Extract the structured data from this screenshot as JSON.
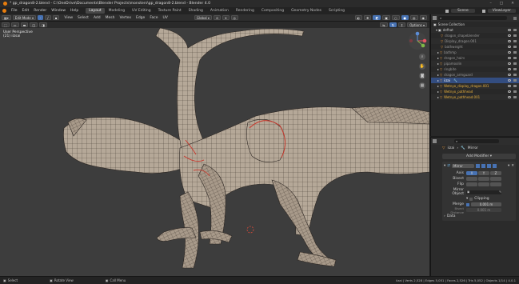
{
  "window": {
    "title": "* gp_dragon8-2.blend - C:\\OneDrive\\Documents\\Blender Projects\\monsters\\gp_dragon8-2.blend - Blender 4.0",
    "controls": [
      "–",
      "□",
      "✕"
    ]
  },
  "menu": [
    "File",
    "Edit",
    "Render",
    "Window",
    "Help"
  ],
  "workspaces": [
    "Layout",
    "Modeling",
    "UV Editing",
    "Texture Paint",
    "Shading",
    "Animation",
    "Rendering",
    "Compositing",
    "Geometry Nodes",
    "Scripting"
  ],
  "active_workspace": "Layout",
  "scene": {
    "label": "Scene",
    "view_layer": "ViewLayer"
  },
  "viewport_header": {
    "mode": "Edit Mode",
    "menus": [
      "View",
      "Select",
      "Add",
      "Mesh",
      "Vertex",
      "Edge",
      "Face",
      "UV"
    ],
    "transform_orientation": "Global",
    "options": "Options"
  },
  "viewport": {
    "perspective": "User Perspective",
    "object_label": "(21) iizsai",
    "accent_wire": "#c83a2e",
    "mesh_color": "#b7aa9a"
  },
  "outliner": {
    "search_placeholder": "",
    "rows": [
      {
        "label": "Scene Collection",
        "indent": 0,
        "icon": "collection"
      },
      {
        "label": "defhat",
        "indent": 1,
        "icon": "collection"
      },
      {
        "label": "dragon_shapeblender",
        "indent": 2,
        "icon": "mesh"
      },
      {
        "label": "Display_dragon.001",
        "indent": 2,
        "icon": "mesh"
      },
      {
        "label": "bathweight",
        "indent": 2,
        "icon": "mesh"
      },
      {
        "label": "bathmp",
        "indent": 1,
        "icon": "mesh"
      },
      {
        "label": "dragon_hairs",
        "indent": 1,
        "icon": "mesh"
      },
      {
        "label": "pipamoolin",
        "indent": 1,
        "icon": "mesh"
      },
      {
        "label": "ringbite",
        "indent": 1,
        "icon": "mesh"
      },
      {
        "label": "dragon_armguard",
        "indent": 1,
        "icon": "mesh"
      },
      {
        "label": "iizai",
        "indent": 1,
        "icon": "mesh",
        "selected": true
      },
      {
        "label": "Wetnyo_display_dragon.001",
        "indent": 1,
        "icon": "mesh"
      },
      {
        "label": "Wetnyo_pathhead",
        "indent": 1,
        "icon": "mesh"
      },
      {
        "label": "Wetnyo_pathhead.001",
        "indent": 1,
        "icon": "mesh"
      }
    ]
  },
  "properties": {
    "object_name": "iizai",
    "modifier_tab": "Mirror",
    "add_modifier": "Add Modifier",
    "modifier_name": "Mirror",
    "axis_label": "Axis",
    "bisect_label": "Bisect",
    "flip_label": "Flip",
    "axes": [
      "X",
      "Y",
      "Z"
    ],
    "mirror_object_label": "Mirror Object",
    "clipping_label": "Clipping",
    "merge_label": "Merge",
    "merge_value": "0.001 m",
    "bisect_distance_label": "Bisect Distance",
    "bisect_distance_value": "0.001 m",
    "data_label": "Data"
  },
  "statusbar": {
    "left": [
      "Select",
      "Rotate View",
      "Call Menu"
    ],
    "right": "iizai | Verts 2,528 | Edges 5,051 | Faces 2,526 | Tris 5,052 | Objects 1/14 | 4.0.1"
  }
}
